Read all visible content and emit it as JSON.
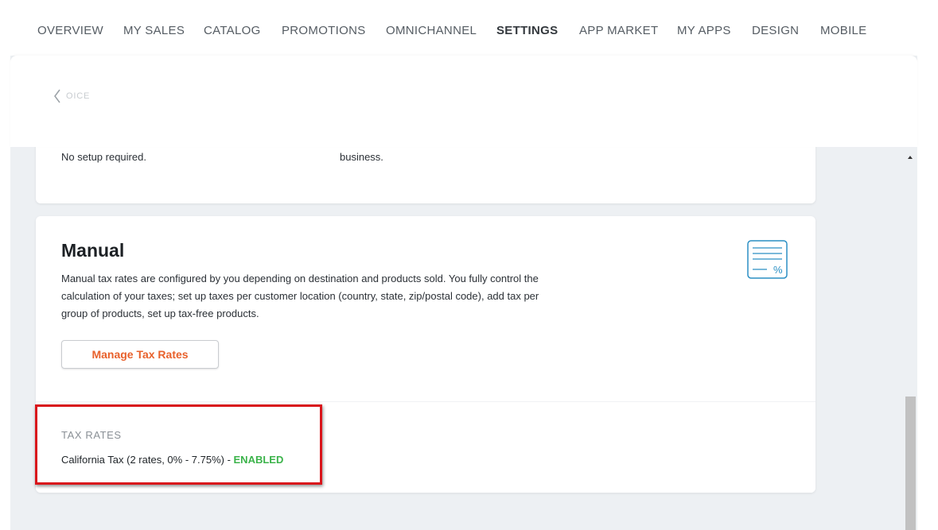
{
  "nav": {
    "items": [
      {
        "label": "OVERVIEW"
      },
      {
        "label": "MY SALES"
      },
      {
        "label": "CATALOG"
      },
      {
        "label": "PROMOTIONS"
      },
      {
        "label": "OMNICHANNEL"
      },
      {
        "label": "SETTINGS"
      },
      {
        "label": "APP MARKET"
      },
      {
        "label": "MY APPS"
      },
      {
        "label": "DESIGN"
      },
      {
        "label": "MOBILE"
      }
    ],
    "active": "SETTINGS"
  },
  "header": {
    "back_label": "OICE",
    "back_icon": "chevron-left-icon"
  },
  "top_card": {
    "left_text": "No setup required.",
    "right_text": "business."
  },
  "manual": {
    "title": "Manual",
    "description": "Manual tax rates are configured by you depending on destination and products sold. You fully control the calculation of your taxes; set up taxes per customer location (country, state, zip/postal code), add tax per group of products, set up tax-free products.",
    "button_label": "Manage Tax Rates",
    "icon": "tax-document-icon",
    "icon_symbol": "%"
  },
  "tax_rates": {
    "heading": "TAX RATES",
    "rate_text": "California Tax (2 rates, 0% - 7.75%) - ",
    "status": "ENABLED"
  },
  "colors": {
    "accent_orange": "#e8612c",
    "enabled_green": "#3bb34a",
    "highlight_red": "#d9151b",
    "icon_blue": "#2a8fc4",
    "workspace_gray": "#edf0f3"
  }
}
